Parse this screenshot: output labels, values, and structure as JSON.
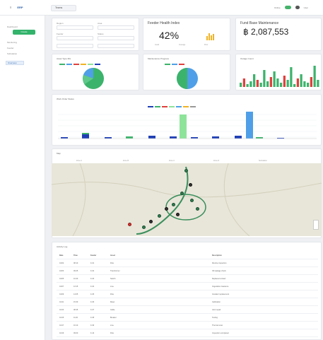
{
  "topbar": {
    "brand": "ERP",
    "tab_label": "Teams",
    "status_label": "Online",
    "user_label": "User"
  },
  "sidebar": {
    "primary_button": "Create",
    "items": [
      "Dashboard",
      "Monitoring",
      "Feeder",
      "Substation"
    ],
    "active_item": "Overview"
  },
  "filters": {
    "labels": [
      "Region",
      "Area",
      "Feeder",
      "Status",
      "From",
      "To"
    ],
    "values": [
      "All",
      "All",
      "All",
      "All",
      "Date",
      "Date"
    ]
  },
  "kpi": {
    "health_title": "Feeder Health Index",
    "health_value": "42%",
    "health_sub": [
      "Good",
      "Average",
      "Poor"
    ],
    "maintenance_title": "Fund Base Maintenance",
    "maintenance_value": "฿ 2,087,553"
  },
  "pies": {
    "left_title": "Asset Type Mix",
    "mid_title": "Maintenance Progress"
  },
  "colors": {
    "green": "#3cb36b",
    "blue": "#4f9fe8",
    "red": "#e0403d",
    "navy": "#1f3fb5",
    "light_green": "#8ee39b"
  },
  "bar_small": {
    "title": "Outage Count",
    "values": [
      3,
      6,
      2,
      4,
      9,
      5,
      3,
      12,
      4,
      7,
      11,
      6,
      3,
      8,
      5,
      14,
      2,
      6,
      9,
      4,
      3,
      7,
      15,
      5
    ]
  },
  "bar_wide": {
    "title": "Work Order Status",
    "xticks": [
      "01",
      "02",
      "03",
      "04",
      "05",
      "06",
      "07",
      "08",
      "09",
      "10",
      "11",
      "12"
    ]
  },
  "map": {
    "title": "Map",
    "legend": [
      "Zone A",
      "Zone B",
      "Zone C",
      "Zone D",
      "Substation"
    ]
  },
  "table": {
    "title": "Activity Log",
    "headers": [
      "Date",
      "Time",
      "Feeder",
      "Asset",
      "Description"
    ],
    "rows": [
      [
        "01/02",
        "08:10",
        "F-01",
        "Pole",
        "Routine inspection"
      ],
      [
        "01/03",
        "09:25",
        "F-02",
        "Transformer",
        "Oil leakage check"
      ],
      [
        "01/05",
        "10:40",
        "F-03",
        "Switch",
        "Replaced contact"
      ],
      [
        "01/07",
        "13:15",
        "F-04",
        "Line",
        "Vegetation clearance"
      ],
      [
        "01/09",
        "14:05",
        "F-05",
        "Pole",
        "Insulator replacement"
      ],
      [
        "01/11",
        "15:30",
        "F-06",
        "Meter",
        "Calibration"
      ],
      [
        "01/13",
        "08:45",
        "F-07",
        "Cable",
        "Joint repair"
      ],
      [
        "01/15",
        "11:20",
        "F-08",
        "Breaker",
        "Testing"
      ],
      [
        "01/17",
        "16:10",
        "F-09",
        "Line",
        "Thermal scan"
      ],
      [
        "01/19",
        "09:00",
        "F-10",
        "Pole",
        "Inspection completed"
      ]
    ]
  }
}
